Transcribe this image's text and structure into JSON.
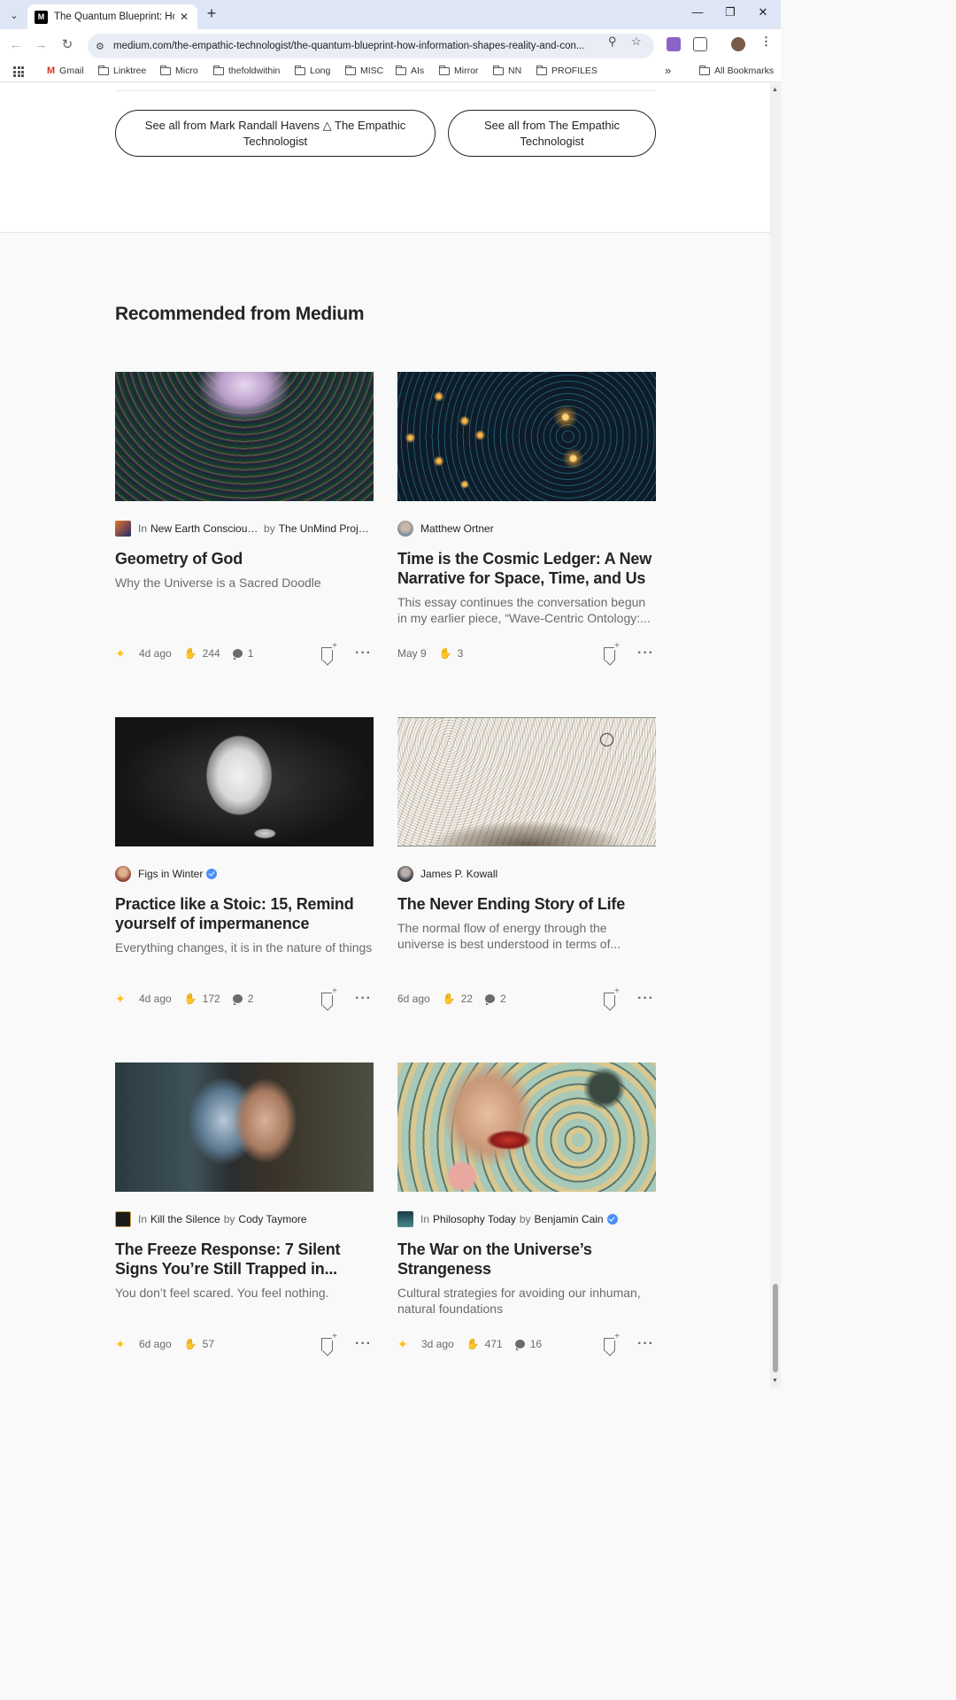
{
  "browser": {
    "tab_title": "The Quantum Blueprint: How Information Shapes Reality",
    "tab_favicon": "M",
    "url": "medium.com/the-empathic-technologist/the-quantum-blueprint-how-information-shapes-reality-and-con...",
    "bookmarks": [
      {
        "label": "Gmail",
        "icon": "gmail-icon"
      },
      {
        "label": "Linktree",
        "icon": "folder-icon"
      },
      {
        "label": "Micro",
        "icon": "folder-icon"
      },
      {
        "label": "thefoldwithin",
        "icon": "folder-icon"
      },
      {
        "label": "Long",
        "icon": "folder-icon"
      },
      {
        "label": "MISC",
        "icon": "folder-icon"
      },
      {
        "label": "AIs",
        "icon": "folder-icon"
      },
      {
        "label": "Mirror",
        "icon": "folder-icon"
      },
      {
        "label": "NN",
        "icon": "folder-icon"
      },
      {
        "label": "PROFILES",
        "icon": "folder-icon"
      }
    ],
    "more_bookmarks": "»",
    "all_bookmarks": "All Bookmarks"
  },
  "pills": {
    "author_line1": "See all from Mark Randall Havens △ The Empathic",
    "author_line2": "Technologist",
    "pub_line1": "See all from The Empathic",
    "pub_line2": "Technologist"
  },
  "section_title": "Recommended from Medium",
  "cards": [
    {
      "publication": "New Earth Consciousn...",
      "author": "The UnMind Projec...",
      "title": "Geometry of God",
      "subtitle": "Why the Universe is a Sacred Doodle",
      "starred": true,
      "date": "4d ago",
      "claps": "244",
      "responses": "1"
    },
    {
      "author": "Matthew Ortner",
      "title": "Time is the Cosmic Ledger: A New Narrative for Space, Time, and Us",
      "subtitle": "This essay continues the conversation begun in my earlier piece, “Wave-Centric Ontology:...",
      "starred": false,
      "date": "May 9",
      "claps": "3"
    },
    {
      "author": "Figs in Winter",
      "verified": true,
      "title": "Practice like a Stoic: 15, Remind yourself of impermanence",
      "subtitle": "Everything changes, it is in the nature of things",
      "starred": true,
      "date": "4d ago",
      "claps": "172",
      "responses": "2"
    },
    {
      "author": "James P. Kowall",
      "title": "The Never Ending Story of Life",
      "subtitle": "The normal flow of energy through the universe is best understood in terms of...",
      "starred": false,
      "date": "6d ago",
      "claps": "22",
      "responses": "2"
    },
    {
      "publication": "Kill the Silence",
      "author": "Cody Taymore",
      "title": "The Freeze Response: 7 Silent Signs You’re Still Trapped in...",
      "subtitle": "You don’t feel scared. You feel nothing.",
      "starred": true,
      "date": "6d ago",
      "claps": "57"
    },
    {
      "publication": "Philosophy Today",
      "author": "Benjamin Cain",
      "verified": true,
      "title": "The War on the Universe’s Strangeness",
      "subtitle": "Cultural strategies for avoiding our inhuman, natural foundations",
      "starred": true,
      "date": "3d ago",
      "claps": "471",
      "responses": "16"
    }
  ],
  "labels": {
    "in": "In",
    "by": "by"
  },
  "colors": {
    "star": "#ffc017",
    "text": "#242424",
    "muted": "#6b6b6b",
    "verified": "#4a8ff7"
  }
}
